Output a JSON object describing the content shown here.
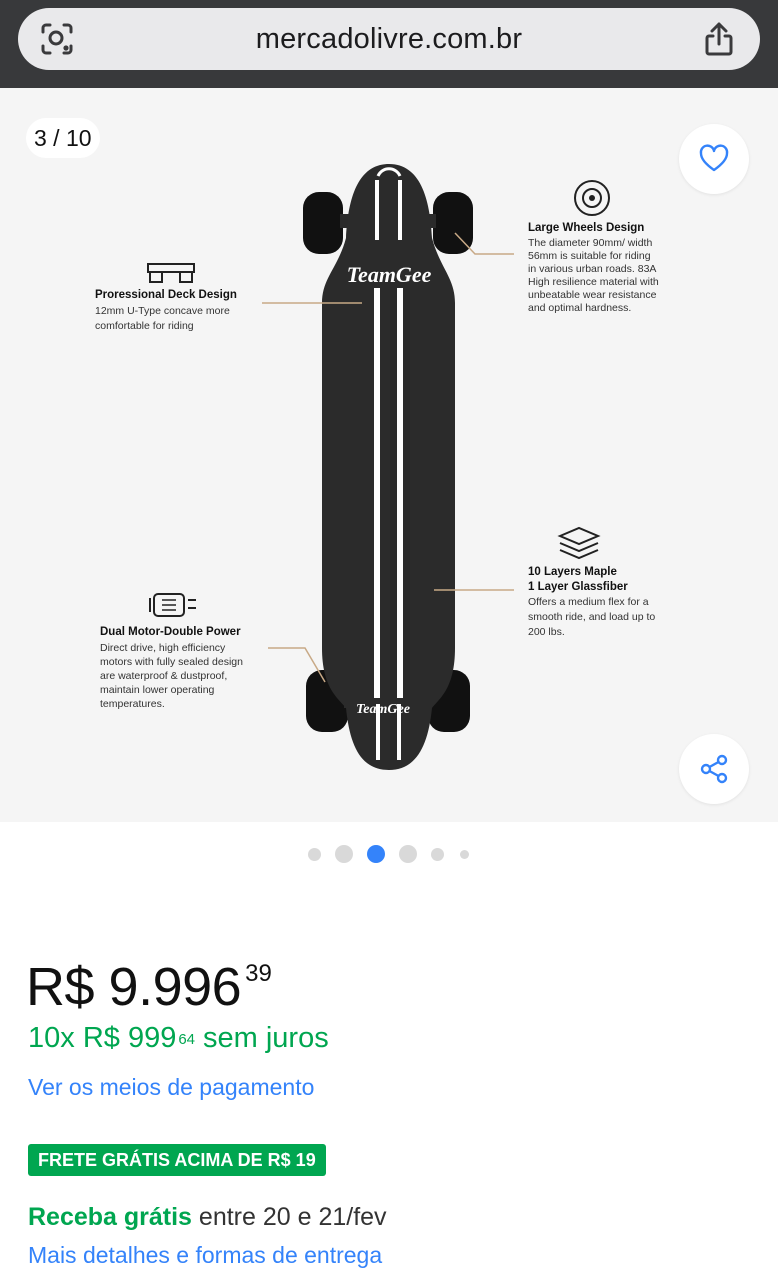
{
  "browser": {
    "url": "mercadolivre.com.br",
    "left_icon": "visual-search-icon",
    "right_icon": "share-icon"
  },
  "gallery": {
    "counter": "3 / 10",
    "favorite_icon": "heart-icon",
    "share_icon": "share-network-icon",
    "active_index": 2,
    "dot_count": 6,
    "image": {
      "brand": "TeamGee",
      "features": [
        {
          "icon": "truck-icon",
          "title": "Proressional Deck Design",
          "lines": [
            "12mm U-Type concave more",
            "comfortable for riding"
          ]
        },
        {
          "icon": "wheel-icon",
          "title": "Large Wheels Design",
          "lines": [
            "The diameter 90mm/ width",
            "56mm is suitable for riding",
            "in various urban roads. 83A",
            "High resilience material with",
            "unbeatable wear resistance",
            "and optimal hardness."
          ]
        },
        {
          "icon": "layers-icon",
          "title": "10 Layers Maple",
          "title2": "1 Layer Glassfiber",
          "lines": [
            "Offers a medium flex for a",
            "smooth ride, and load up to",
            "200 lbs."
          ]
        },
        {
          "icon": "motor-icon",
          "title": "Dual Motor-Double Power",
          "lines": [
            "Direct drive, high efficiency",
            "motors with fully sealed design",
            "are waterproof & dustproof,",
            "maintain lower operating",
            "temperatures."
          ]
        }
      ]
    }
  },
  "price": {
    "main": "R$ 9.996",
    "cents": "39"
  },
  "installments": {
    "prefix": "10x R$ 999",
    "cents": "64",
    "suffix": "sem juros"
  },
  "payment_link": "Ver os meios de pagamento",
  "shipping_badge": "FRETE GRÁTIS ACIMA DE R$ 19",
  "delivery": {
    "highlight": "Receba grátis",
    "rest": "entre 20 e 21/fev"
  },
  "details_link": "Mais detalhes e formas de entrega",
  "colors": {
    "green": "#00a650",
    "blue": "#3483fa",
    "active_dot": "#3483fa"
  }
}
